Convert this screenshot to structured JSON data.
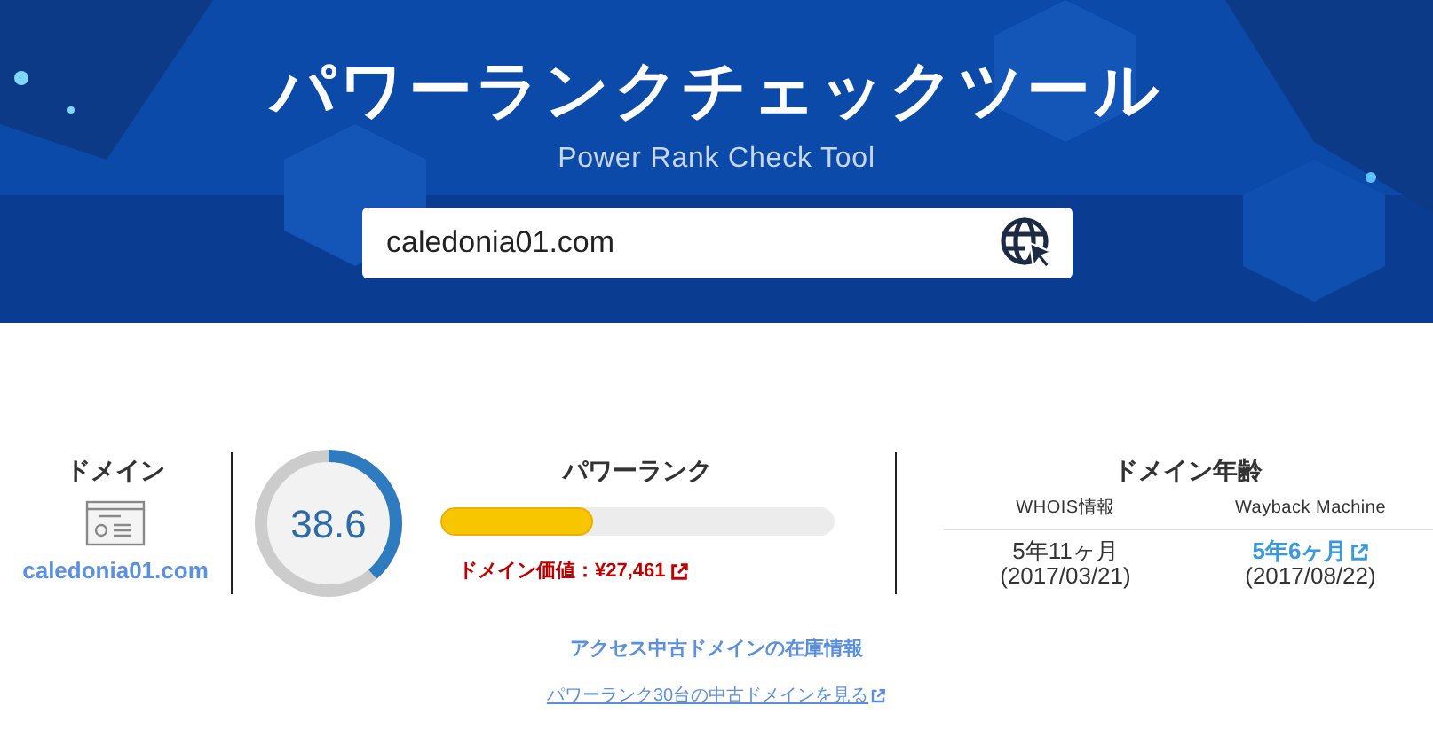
{
  "header": {
    "title": "パワーランクチェックツール",
    "subtitle": "Power Rank Check Tool",
    "search": {
      "value": "caledonia01.com"
    }
  },
  "domain": {
    "heading": "ドメイン",
    "name": "caledonia01.com"
  },
  "power_rank": {
    "score": "38.6",
    "gauge": {
      "level": 0.386
    },
    "heading": "パワーランク",
    "level": 0.386,
    "value_label": "ドメイン価値：",
    "value": "¥27,461"
  },
  "domain_age": {
    "heading": "ドメイン年齢",
    "columns": [
      {
        "label": "WHOIS情報",
        "age": "5年11ヶ月",
        "date": "(2017/03/21)",
        "link": false
      },
      {
        "label": "Wayback Machine",
        "age": "5年6ヶ月",
        "date": "(2017/08/22)",
        "link": true
      }
    ]
  },
  "stock": {
    "title": "アクセス中古ドメインの在庫情報",
    "link": "パワーランク30台の中古ドメインを見る"
  }
}
